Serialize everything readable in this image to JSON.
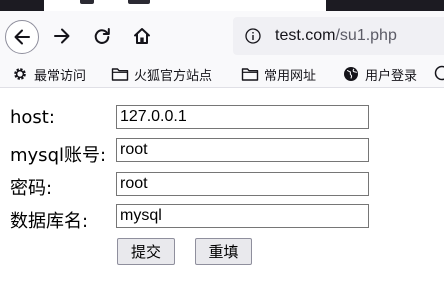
{
  "browser": {
    "url_host": "test.com",
    "url_path": "/su1.php",
    "bookmarks": [
      {
        "label": "最常访问",
        "icon": "gear-icon"
      },
      {
        "label": "火狐官方站点",
        "icon": "folder-icon"
      },
      {
        "label": "常用网址",
        "icon": "folder-icon"
      },
      {
        "label": "用户登录",
        "icon": "globe-icon"
      }
    ]
  },
  "form": {
    "fields": [
      {
        "label": "host:",
        "value": "127.0.0.1"
      },
      {
        "label": "mysql账号:",
        "value": "root"
      },
      {
        "label": "密码:",
        "value": "root"
      },
      {
        "label": "数据库名:",
        "value": "mysql"
      }
    ],
    "submit_label": "提交",
    "reset_label": "重填"
  }
}
